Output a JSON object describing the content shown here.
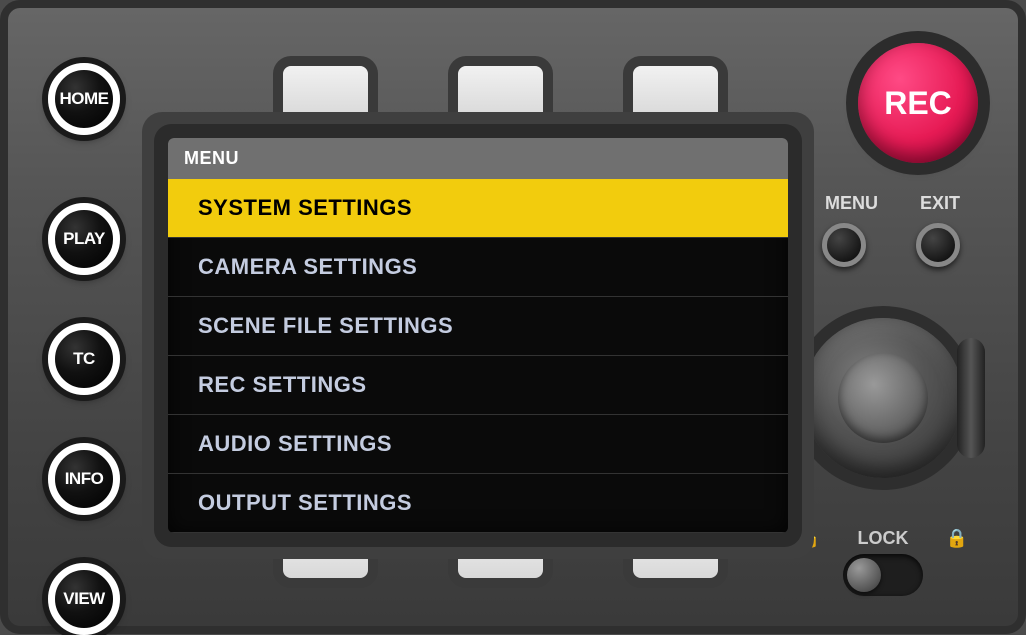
{
  "buttons": {
    "home": "HOME",
    "play": "PLAY",
    "tc": "TC",
    "info": "INFO",
    "view": "VIEW",
    "rec": "REC",
    "menu_label": "MENU",
    "exit_label": "EXIT",
    "lock_label": "LOCK"
  },
  "screen": {
    "header": "MENU",
    "items": [
      {
        "label": "SYSTEM SETTINGS",
        "selected": true
      },
      {
        "label": "CAMERA SETTINGS",
        "selected": false
      },
      {
        "label": "SCENE FILE SETTINGS",
        "selected": false
      },
      {
        "label": "REC SETTINGS",
        "selected": false
      },
      {
        "label": "AUDIO SETTINGS",
        "selected": false
      },
      {
        "label": "OUTPUT SETTINGS",
        "selected": false
      }
    ]
  },
  "colors": {
    "highlight": "#f2cc0d",
    "rec": "#e71b55"
  }
}
